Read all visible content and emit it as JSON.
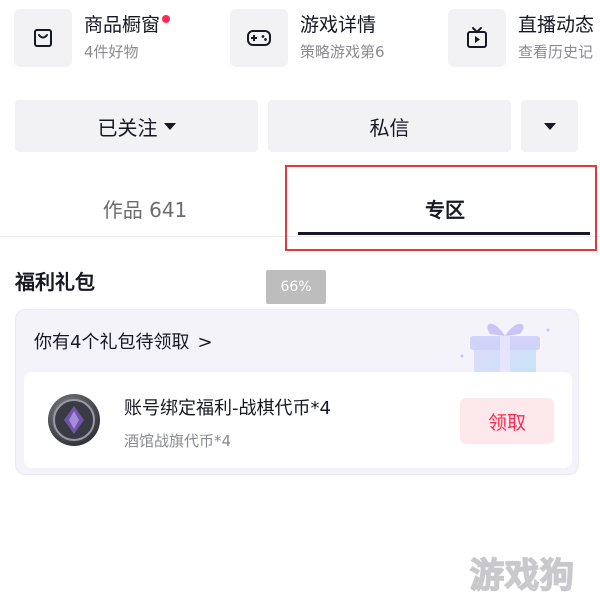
{
  "entries": [
    {
      "title": "商品橱窗",
      "subtitle": "4件好物",
      "icon": "shop-window-icon",
      "has_dot": true
    },
    {
      "title": "游戏详情",
      "subtitle": "策略游戏第6",
      "icon": "gamepad-icon",
      "has_dot": false
    },
    {
      "title": "直播动态",
      "subtitle": "查看历史记",
      "icon": "tv-icon",
      "has_dot": false
    }
  ],
  "actions": {
    "follow_label": "已关注",
    "message_label": "私信"
  },
  "tabs": {
    "works_label": "作品 641",
    "zone_label": "专区",
    "active": "专区"
  },
  "section": {
    "title": "福利礼包"
  },
  "zoom_badge": "66%",
  "gift": {
    "count_text": "你有4个礼包待领取",
    "chevron": ">",
    "item": {
      "title": "账号绑定福利-战棋代币*4",
      "subtitle": "酒馆战旗代币*4",
      "claim_label": "领取"
    }
  },
  "watermark": "游戏狗",
  "colors": {
    "accent": "#fe2c55",
    "highlight_box": "#e03a3a",
    "button_bg": "#f2f2f4",
    "text_primary": "#161823",
    "text_secondary": "#8a8b91"
  }
}
